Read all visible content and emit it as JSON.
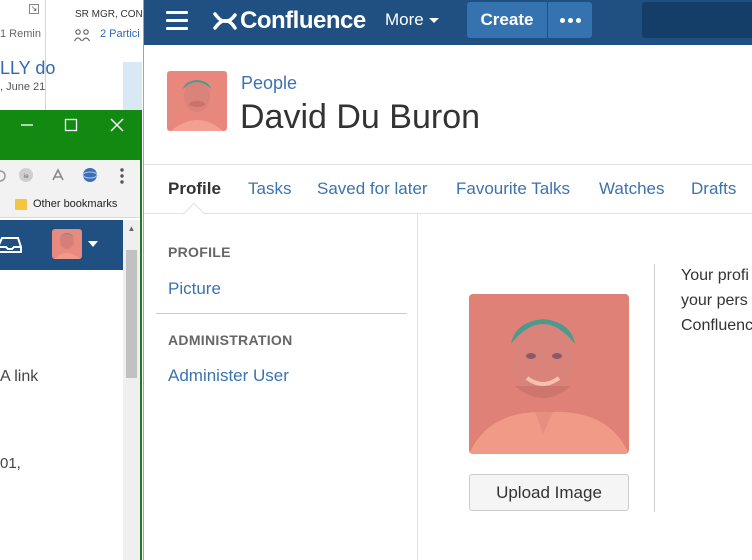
{
  "outlook": {
    "reminder_text": "1 Remin",
    "corner_glyph": "↘",
    "bold_text": "LLY do",
    "date_text": ", June 21",
    "sender_text": "SR MGR, CON",
    "participants_text": "2 Partici"
  },
  "chrome": {
    "bookmarks_label": "Other bookmarks",
    "body_link_text": "A link",
    "body_year_text": "01,"
  },
  "confluence": {
    "logo_text": "Confluence",
    "more_label": "More",
    "create_label": "Create",
    "breadcrumb": "People",
    "title": "David Du Buron",
    "tabs": [
      {
        "label": "Profile",
        "active": true
      },
      {
        "label": "Tasks"
      },
      {
        "label": "Saved for later"
      },
      {
        "label": "Favourite Talks"
      },
      {
        "label": "Watches"
      },
      {
        "label": "Drafts"
      }
    ],
    "sidebar": {
      "profile_heading": "PROFILE",
      "picture_link": "Picture",
      "admin_heading": "ADMINISTRATION",
      "admin_link": "Administer User"
    },
    "upload_label": "Upload Image",
    "description_lines": [
      "Your profi",
      "your pers",
      "Confluenc"
    ],
    "colors": {
      "header_blue": "#205081",
      "button_blue": "#3572b0",
      "link_blue": "#3b73af",
      "chrome_green": "#128a12"
    }
  }
}
